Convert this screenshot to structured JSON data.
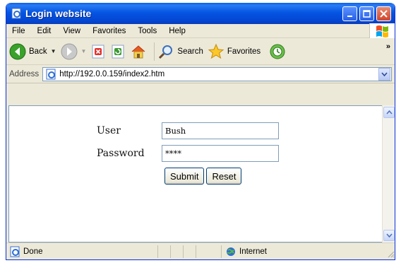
{
  "window": {
    "title": "Login website"
  },
  "menu": {
    "items": [
      "File",
      "Edit",
      "View",
      "Favorites",
      "Tools",
      "Help"
    ]
  },
  "toolbar": {
    "back": "Back",
    "search": "Search",
    "favorites": "Favorites"
  },
  "address": {
    "label": "Address",
    "url": "http://192.0.0.159/index2.htm"
  },
  "form": {
    "user_label": "User",
    "user_value": "Bush",
    "password_label": "Password",
    "password_value": "****",
    "submit": "Submit",
    "reset": "Reset"
  },
  "status": {
    "text": "Done",
    "zone": "Internet"
  },
  "icons": [
    "ie-page-icon",
    "minimize-icon",
    "maximize-icon",
    "close-icon",
    "windows-flag-icon",
    "back-arrow-icon",
    "forward-arrow-icon",
    "stop-icon",
    "refresh-icon",
    "home-icon",
    "search-icon",
    "favorites-star-icon",
    "history-icon",
    "chevron-right-icon",
    "dropdown-arrow-icon",
    "globe-icon",
    "resize-grip-icon"
  ],
  "colors": {
    "titlebar": "#0a5fe8",
    "window_frame": "#ece9d8",
    "close": "#d1442a",
    "back_green": "#3aa12b"
  }
}
